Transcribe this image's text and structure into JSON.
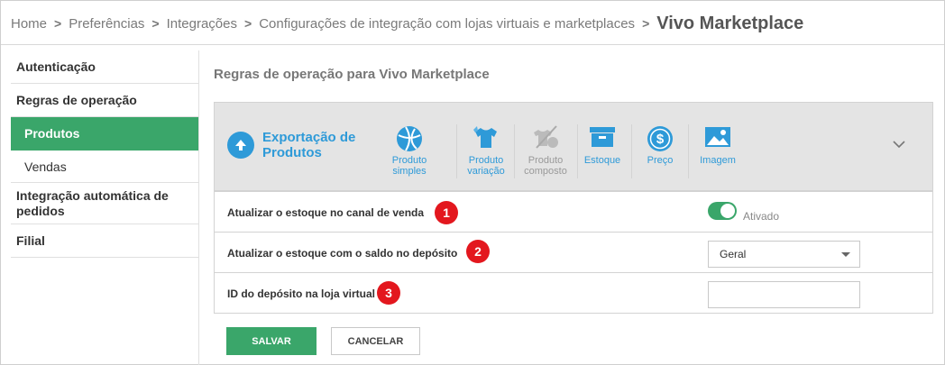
{
  "breadcrumb": {
    "items": [
      "Home",
      "Preferências",
      "Integrações",
      "Configurações de integração com lojas virtuais e marketplaces"
    ],
    "current": "Vivo Marketplace",
    "separator": ">"
  },
  "sidebar": {
    "items": [
      {
        "label": "Autenticação"
      },
      {
        "label": "Regras de operação"
      },
      {
        "label": "Produtos",
        "active": true
      },
      {
        "label": "Vendas"
      },
      {
        "label": "Integração automática de pedidos"
      },
      {
        "label": "Filial"
      }
    ]
  },
  "main": {
    "title": "Regras de operação para Vivo Marketplace",
    "export": {
      "title": "Exportação de Produtos",
      "icon": "arrow-up-circle-icon",
      "tools": [
        {
          "label": "Produto simples",
          "icon": "ball-icon",
          "enabled": true
        },
        {
          "label": "Produto variação",
          "icon": "tshirt-icon",
          "enabled": true
        },
        {
          "label": "Produto composto",
          "icon": "tshirt-ball-icon",
          "enabled": false
        },
        {
          "label": "Estoque",
          "icon": "box-icon",
          "enabled": true
        },
        {
          "label": "Preço",
          "icon": "dollar-icon",
          "enabled": true
        },
        {
          "label": "Imagem",
          "icon": "image-icon",
          "enabled": true
        }
      ]
    },
    "rows": [
      {
        "label": "Atualizar o estoque no canal de venda",
        "badge": "1",
        "toggle_label": "Ativado",
        "toggle_on": true
      },
      {
        "label": "Atualizar o estoque com o saldo no depósito",
        "badge": "2",
        "select_value": "Geral"
      },
      {
        "label": "ID do depósito na loja virtual",
        "badge": "3",
        "input_value": ""
      }
    ]
  },
  "actions": {
    "save": "SALVAR",
    "cancel": "CANCELAR"
  },
  "colors": {
    "accent_green": "#3aa66a",
    "link_blue": "#2e9ad8",
    "badge_red": "#e3171e"
  }
}
